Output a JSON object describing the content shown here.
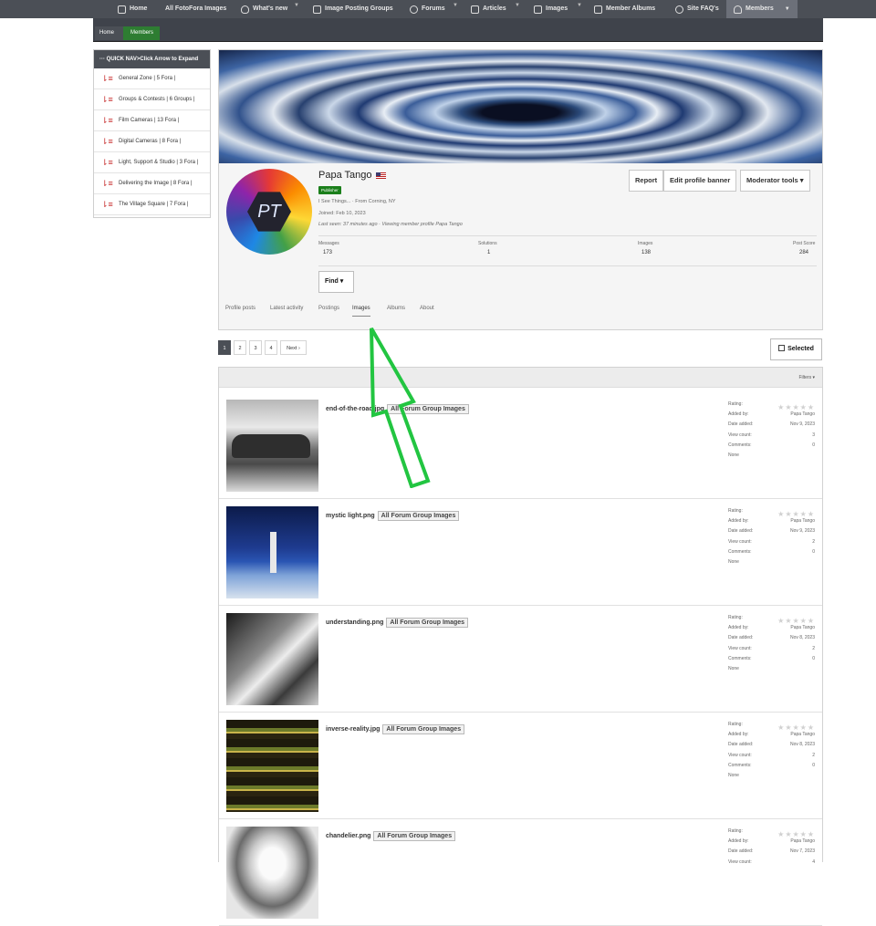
{
  "nav": {
    "items": [
      {
        "label": "Home",
        "icon": "home-icon"
      },
      {
        "label": "All FotoFora Images",
        "icon": ""
      },
      {
        "label": "What's new",
        "icon": "flame-icon"
      },
      {
        "label": "Image Posting Groups",
        "icon": "camera-icon"
      },
      {
        "label": "Forums",
        "icon": "chat-icon"
      },
      {
        "label": "Articles",
        "icon": "book-icon"
      },
      {
        "label": "Images",
        "icon": "image-icon"
      },
      {
        "label": "Member Albums",
        "icon": "album-icon"
      },
      {
        "label": "Site FAQ's",
        "icon": "globe-icon"
      },
      {
        "label": "Members",
        "icon": "user-icon"
      }
    ]
  },
  "breadcrumb": {
    "home": "Home",
    "current": "Members"
  },
  "sidebar": {
    "header": "··· QUICK NAV>Click Arrow to Expand",
    "items": [
      {
        "label": "General Zone | 5 Fora |"
      },
      {
        "label": "Groups & Contests | 6 Groups |"
      },
      {
        "label": "Film Cameras | 13 Fora |"
      },
      {
        "label": "Digital Cameras | 8 Fora |"
      },
      {
        "label": "Light, Support & Studio | 3 Fora |"
      },
      {
        "label": "Delivering the Image | 8 Fora |"
      },
      {
        "label": "The Village Square | 7 Fora |"
      }
    ]
  },
  "profile": {
    "name": "Papa Tango",
    "avatar_initials": "PT",
    "badge": "Publisher",
    "tagline": "I See Things... · From Corning, NY",
    "joined": "Joined: Feb 10, 2023",
    "last_seen_prefix": "Last seen: 37 minutes ago · Viewing member profile",
    "last_seen_name": "Papa Tango",
    "buttons": {
      "report": "Report",
      "edit_banner": "Edit profile banner",
      "moderator": "Moderator tools ▾"
    },
    "stats": [
      {
        "label": "Messages",
        "value": "173"
      },
      {
        "label": "Solutions",
        "value": "1"
      },
      {
        "label": "Images",
        "value": "138"
      },
      {
        "label": "Post Score",
        "value": "284"
      }
    ],
    "find": "Find ▾",
    "tabs": [
      "Profile posts",
      "Latest activity",
      "Postings",
      "Images",
      "Albums",
      "About"
    ],
    "active_tab": "Images"
  },
  "pagination": {
    "pages": [
      "1",
      "2",
      "3",
      "4"
    ],
    "next": "Next ›",
    "current": "1"
  },
  "selected_button": "Selected",
  "filters": "Filters ▾",
  "meta_labels": {
    "rating": "Rating:",
    "added_by": "Added by:",
    "date_added": "Date added:",
    "view_count": "View count:",
    "comments": "Comments:",
    "none": "None"
  },
  "images": [
    {
      "name": "end-of-the-road.jpg",
      "category": "All Forum Group Images",
      "added_by": "Papa Tango",
      "date": "Nov 9, 2023",
      "views": "3",
      "comments": "0"
    },
    {
      "name": "mystic light.png",
      "category": "All Forum Group Images",
      "added_by": "Papa Tango",
      "date": "Nov 9, 2023",
      "views": "2",
      "comments": "0"
    },
    {
      "name": "understanding.png",
      "category": "All Forum Group Images",
      "added_by": "Papa Tango",
      "date": "Nov 8, 2023",
      "views": "2",
      "comments": "0"
    },
    {
      "name": "inverse-reality.jpg",
      "category": "All Forum Group Images",
      "added_by": "Papa Tango",
      "date": "Nov 8, 2023",
      "views": "2",
      "comments": "0"
    },
    {
      "name": "chandelier.png",
      "category": "All Forum Group Images",
      "added_by": "Papa Tango",
      "date": "Nov 7, 2023",
      "views": "4",
      "comments": ""
    }
  ],
  "colors": {
    "nav_bg": "#4b4f56",
    "accent_green": "#2e7d32",
    "arrow_green": "#22c541"
  }
}
